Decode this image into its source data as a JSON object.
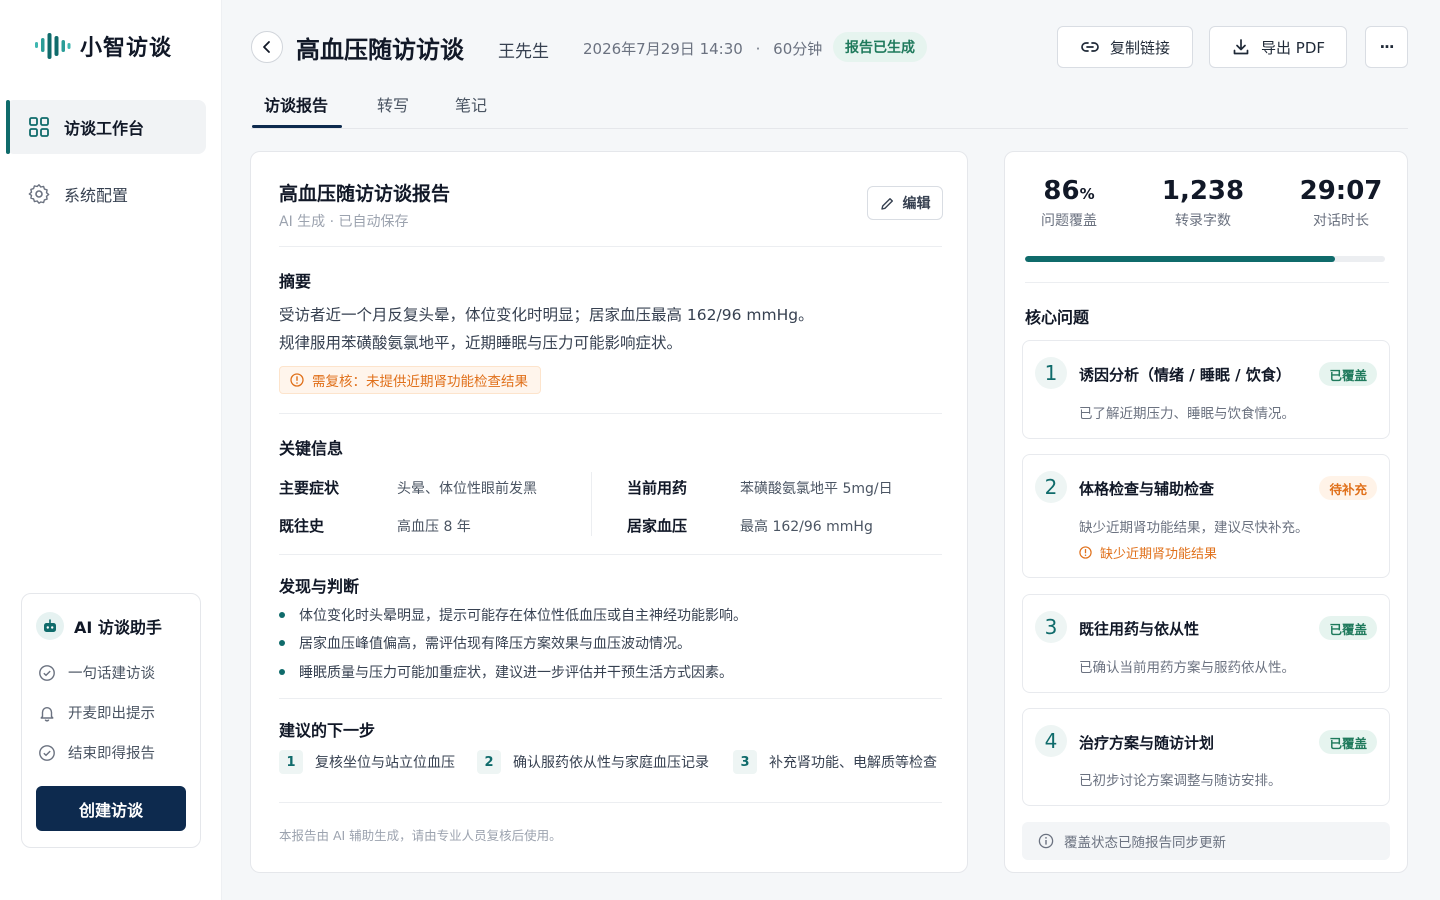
{
  "app": {
    "name": "小智访谈"
  },
  "sidebar": {
    "items": [
      {
        "label": "访谈工作台",
        "icon": "grid-icon",
        "active": true
      },
      {
        "label": "系统配置",
        "icon": "gear-icon",
        "active": false
      }
    ],
    "assistant": {
      "title": "AI 访谈助手",
      "items": [
        {
          "label": "一句话建访谈",
          "icon": "chat-check-icon"
        },
        {
          "label": "开麦即出提示",
          "icon": "bell-icon"
        },
        {
          "label": "结束即得报告",
          "icon": "report-check-icon"
        }
      ],
      "create_label": "创建访谈"
    }
  },
  "header": {
    "title": "高血压随访访谈",
    "patient": "王先生",
    "datetime": "2026年7月29日 14:30",
    "separator": "·",
    "duration": "60分钟",
    "status": "报告已生成",
    "copy_link_label": "复制链接",
    "export_label": "导出 PDF",
    "more_label": "···"
  },
  "tabs": [
    {
      "label": "访谈报告",
      "active": true
    },
    {
      "label": "转写",
      "active": false
    },
    {
      "label": "笔记",
      "active": false
    }
  ],
  "report": {
    "title": "高血压随访访谈报告",
    "subtitle": "AI 生成 · 已自动保存",
    "edit_label": "编辑",
    "summary_title": "摘要",
    "summary_lines": [
      "受访者近一个月反复头晕，体位变化时明显；居家血压最高 162/96 mmHg。",
      "规律服用苯磺酸氨氯地平，近期睡眠与压力可能影响症状。"
    ],
    "review_note": "需复核：未提供近期肾功能检查结果",
    "key_info_title": "关键信息",
    "key_info": [
      {
        "label": "主要症状",
        "value": "头晕、体位性眼前发黑"
      },
      {
        "label": "当前用药",
        "value": "苯磺酸氨氯地平 5mg/日"
      },
      {
        "label": "既往史",
        "value": "高血压 8 年"
      },
      {
        "label": "居家血压",
        "value": "最高 162/96 mmHg"
      }
    ],
    "findings_title": "发现与判断",
    "findings": [
      "体位变化时头晕明显，提示可能存在体位性低血压或自主神经功能影响。",
      "居家血压峰值偏高，需评估现有降压方案效果与血压波动情况。",
      "睡眠质量与压力可能加重症状，建议进一步评估并干预生活方式因素。"
    ],
    "next_title": "建议的下一步",
    "next_steps": [
      {
        "num": "1",
        "label": "复核坐位与站立位血压"
      },
      {
        "num": "2",
        "label": "确认服药依从性与家庭血压记录"
      },
      {
        "num": "3",
        "label": "补充肾功能、电解质等检查"
      }
    ],
    "footnote": "本报告由 AI 辅助生成，请由专业人员复核后使用。"
  },
  "stats": {
    "coverage_value": "86",
    "coverage_unit": "%",
    "coverage_label": "问题覆盖",
    "coverage_fraction": 0.86,
    "words_value": "1,238",
    "words_label": "转录字数",
    "time_value": "29:07",
    "time_label": "对话时长"
  },
  "core": {
    "title": "核心问题",
    "questions": [
      {
        "num": "1",
        "title": "诱因分析（情绪 / 睡眠 / 饮食）",
        "desc": "已了解近期压力、睡眠与饮食情况。",
        "status": "已覆盖",
        "state": "ok"
      },
      {
        "num": "2",
        "title": "体格检查与辅助检查",
        "desc": "缺少近期肾功能结果，建议尽快补充。",
        "status": "待补充",
        "state": "pending",
        "warn": "缺少近期肾功能结果"
      },
      {
        "num": "3",
        "title": "既往用药与依从性",
        "desc": "已确认当前用药方案与服药依从性。",
        "status": "已覆盖",
        "state": "ok"
      },
      {
        "num": "4",
        "title": "治疗方案与随访计划",
        "desc": "已初步讨论方案调整与随访安排。",
        "status": "已覆盖",
        "state": "ok"
      }
    ],
    "info": "覆盖状态已随报告同步更新"
  },
  "colors": {
    "accent": "#0f6b6b",
    "primary": "#0d2a4e",
    "warning": "#e0701a",
    "success": "#1f7a5c"
  }
}
